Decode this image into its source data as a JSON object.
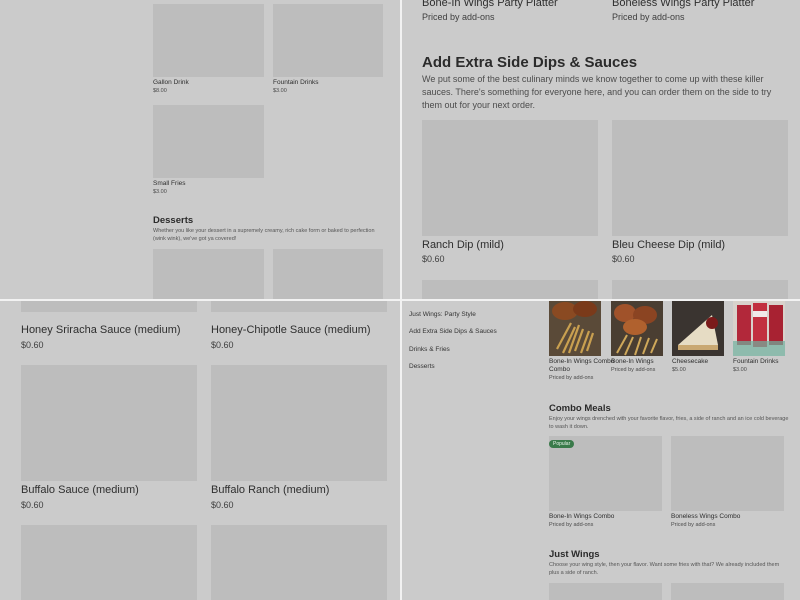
{
  "q1": {
    "items": [
      {
        "name": "Gallon Drink",
        "price": "$8.00"
      },
      {
        "name": "Fountain Drinks",
        "price": "$3.00"
      },
      {
        "name": "Small Fries",
        "price": "$3.00"
      }
    ],
    "desserts": {
      "title": "Desserts",
      "description": "Whether you like your dessert in a supremely creamy, rich cake form or baked to perfection (wink wink), we've got ya covered!"
    }
  },
  "q2": {
    "top_items": [
      {
        "name": "Bone-In Wings Party Platter",
        "price": "Priced by add-ons"
      },
      {
        "name": "Boneless Wings Party Platter",
        "price": "Priced by add-ons"
      }
    ],
    "section": {
      "title": "Add Extra Side Dips & Sauces",
      "description": "We put some of the best culinary minds we know together to come up with these killer sauces. There's something for everyone here, and you can order them on the side to try them out for your next order."
    },
    "items": [
      {
        "name": "Ranch Dip (mild)",
        "price": "$0.60"
      },
      {
        "name": "Bleu Cheese Dip (mild)",
        "price": "$0.60"
      }
    ]
  },
  "q3": {
    "items": [
      {
        "name": "Honey Sriracha Sauce (medium)",
        "price": "$0.60"
      },
      {
        "name": "Honey-Chipotle Sauce (medium)",
        "price": "$0.60"
      },
      {
        "name": "Buffalo Sauce (medium)",
        "price": "$0.60"
      },
      {
        "name": "Buffalo Ranch (medium)",
        "price": "$0.60"
      }
    ]
  },
  "q4": {
    "nav": [
      {
        "label": "Just Wings: Party Style"
      },
      {
        "label": "Add Extra Side Dips & Sauces"
      },
      {
        "label": "Drinks & Fries"
      },
      {
        "label": "Desserts"
      }
    ],
    "featured": [
      {
        "name": "Bone-In Wings Combo",
        "price": "Priced by add-ons",
        "icon": "fries-and-wings-photo"
      },
      {
        "name": "Bone-In Wings",
        "price": "Priced by add-ons",
        "icon": "wings-photo"
      },
      {
        "name": "Cheesecake",
        "price": "$5.00",
        "icon": "cheesecake-photo"
      },
      {
        "name": "Fountain Drinks",
        "price": "$3.00",
        "icon": "soda-cups-photo"
      }
    ],
    "combo": {
      "title": "Combo Meals",
      "description": "Enjoy your wings drenched with your favorite flavor, fries, a side of ranch and an ice cold beverage to wash it down.",
      "badge": "Popular",
      "items": [
        {
          "name": "Bone-In Wings Combo",
          "price": "Priced by add-ons"
        },
        {
          "name": "Boneless Wings Combo",
          "price": "Priced by add-ons"
        }
      ]
    },
    "just_wings": {
      "title": "Just Wings",
      "description": "Choose your wing style, then your flavor. Want some fries with that? We already included them plus a side of ranch."
    }
  },
  "colors": {
    "overlay": "#cbcbcb",
    "placeholder": "#bdbdbd",
    "badge": "#3a7a4a",
    "divider": "#f2f2f2"
  }
}
